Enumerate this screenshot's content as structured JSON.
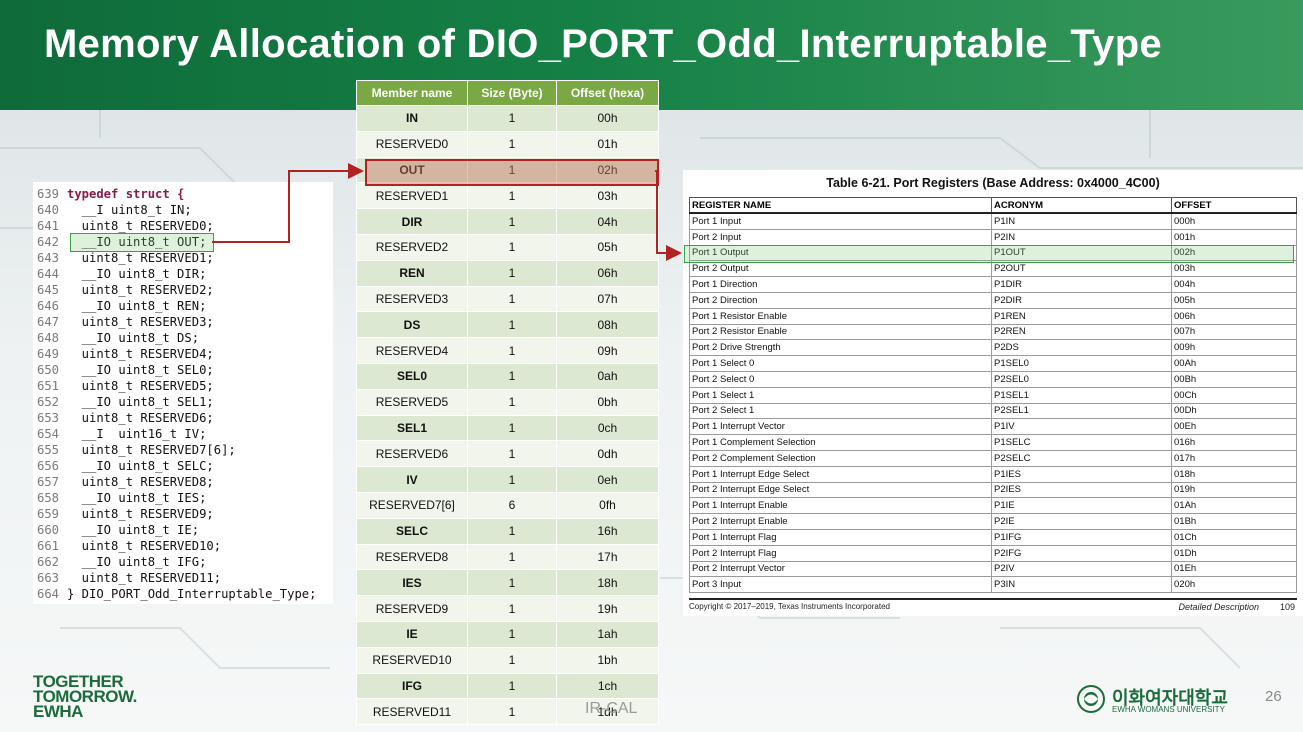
{
  "slide": {
    "title": "Memory Allocation of DIO_PORT_Odd_Interruptable_Type",
    "page_number": "26",
    "watermark": "IR-CAL",
    "logo_left": [
      "TOGETHER",
      "TOMORROW.",
      "EWHA"
    ],
    "logo_right_kr": "이화여자대학교",
    "logo_right_en": "EWHA WOMANS UNIVERSITY"
  },
  "code": [
    {
      "n": "639",
      "t": "typedef struct {"
    },
    {
      "n": "640",
      "t": "  __I uint8_t IN;"
    },
    {
      "n": "641",
      "t": "  uint8_t RESERVED0;"
    },
    {
      "n": "642",
      "t": "  __IO uint8_t OUT;"
    },
    {
      "n": "643",
      "t": "  uint8_t RESERVED1;"
    },
    {
      "n": "644",
      "t": "  __IO uint8_t DIR;"
    },
    {
      "n": "645",
      "t": "  uint8_t RESERVED2;"
    },
    {
      "n": "646",
      "t": "  __IO uint8_t REN;"
    },
    {
      "n": "647",
      "t": "  uint8_t RESERVED3;"
    },
    {
      "n": "648",
      "t": "  __IO uint8_t DS;"
    },
    {
      "n": "649",
      "t": "  uint8_t RESERVED4;"
    },
    {
      "n": "650",
      "t": "  __IO uint8_t SEL0;"
    },
    {
      "n": "651",
      "t": "  uint8_t RESERVED5;"
    },
    {
      "n": "652",
      "t": "  __IO uint8_t SEL1;"
    },
    {
      "n": "653",
      "t": "  uint8_t RESERVED6;"
    },
    {
      "n": "654",
      "t": "  __I  uint16_t IV;"
    },
    {
      "n": "655",
      "t": "  uint8_t RESERVED7[6];"
    },
    {
      "n": "656",
      "t": "  __IO uint8_t SELC;"
    },
    {
      "n": "657",
      "t": "  uint8_t RESERVED8;"
    },
    {
      "n": "658",
      "t": "  __IO uint8_t IES;"
    },
    {
      "n": "659",
      "t": "  uint8_t RESERVED9;"
    },
    {
      "n": "660",
      "t": "  __IO uint8_t IE;"
    },
    {
      "n": "661",
      "t": "  uint8_t RESERVED10;"
    },
    {
      "n": "662",
      "t": "  __IO uint8_t IFG;"
    },
    {
      "n": "663",
      "t": "  uint8_t RESERVED11;"
    },
    {
      "n": "664",
      "t": "} DIO_PORT_Odd_Interruptable_Type;"
    }
  ],
  "member_table": {
    "headers": [
      "Member name",
      "Size (Byte)",
      "Offset (hexa)"
    ],
    "rows": [
      [
        "IN",
        "1",
        "00h"
      ],
      [
        "RESERVED0",
        "1",
        "01h"
      ],
      [
        "OUT",
        "1",
        "02h"
      ],
      [
        "RESERVED1",
        "1",
        "03h"
      ],
      [
        "DIR",
        "1",
        "04h"
      ],
      [
        "RESERVED2",
        "1",
        "05h"
      ],
      [
        "REN",
        "1",
        "06h"
      ],
      [
        "RESERVED3",
        "1",
        "07h"
      ],
      [
        "DS",
        "1",
        "08h"
      ],
      [
        "RESERVED4",
        "1",
        "09h"
      ],
      [
        "SEL0",
        "1",
        "0ah"
      ],
      [
        "RESERVED5",
        "1",
        "0bh"
      ],
      [
        "SEL1",
        "1",
        "0ch"
      ],
      [
        "RESERVED6",
        "1",
        "0dh"
      ],
      [
        "IV",
        "1",
        "0eh"
      ],
      [
        "RESERVED7[6]",
        "6",
        "0fh"
      ],
      [
        "SELC",
        "1",
        "16h"
      ],
      [
        "RESERVED8",
        "1",
        "17h"
      ],
      [
        "IES",
        "1",
        "18h"
      ],
      [
        "RESERVED9",
        "1",
        "19h"
      ],
      [
        "IE",
        "1",
        "1ah"
      ],
      [
        "RESERVED10",
        "1",
        "1bh"
      ],
      [
        "IFG",
        "1",
        "1ch"
      ],
      [
        "RESERVED11",
        "1",
        "1dh"
      ]
    ]
  },
  "datasheet": {
    "title": "Table 6-21. Port Registers (Base Address: 0x4000_4C00)",
    "headers": [
      "REGISTER NAME",
      "ACRONYM",
      "OFFSET"
    ],
    "rows": [
      [
        "Port 1 Input",
        "P1IN",
        "000h"
      ],
      [
        "Port 2 Input",
        "P2IN",
        "001h"
      ],
      [
        "Port 1 Output",
        "P1OUT",
        "002h"
      ],
      [
        "Port 2 Output",
        "P2OUT",
        "003h"
      ],
      [
        "Port 1 Direction",
        "P1DIR",
        "004h"
      ],
      [
        "Port 2 Direction",
        "P2DIR",
        "005h"
      ],
      [
        "Port 1 Resistor Enable",
        "P1REN",
        "006h"
      ],
      [
        "Port 2 Resistor Enable",
        "P2REN",
        "007h"
      ],
      [
        "Port 2 Drive Strength",
        "P2DS",
        "009h"
      ],
      [
        "Port 1 Select 0",
        "P1SEL0",
        "00Ah"
      ],
      [
        "Port 2 Select 0",
        "P2SEL0",
        "00Bh"
      ],
      [
        "Port 1 Select 1",
        "P1SEL1",
        "00Ch"
      ],
      [
        "Port 2 Select 1",
        "P2SEL1",
        "00Dh"
      ],
      [
        "Port 1 Interrupt Vector",
        "P1IV",
        "00Eh"
      ],
      [
        "Port 1 Complement Selection",
        "P1SELC",
        "016h"
      ],
      [
        "Port 2 Complement Selection",
        "P2SELC",
        "017h"
      ],
      [
        "Port 1 Interrupt Edge Select",
        "P1IES",
        "018h"
      ],
      [
        "Port 2 Interrupt Edge Select",
        "P2IES",
        "019h"
      ],
      [
        "Port 1 Interrupt Enable",
        "P1IE",
        "01Ah"
      ],
      [
        "Port 2 Interrupt Enable",
        "P2IE",
        "01Bh"
      ],
      [
        "Port 1 Interrupt Flag",
        "P1IFG",
        "01Ch"
      ],
      [
        "Port 2 Interrupt Flag",
        "P2IFG",
        "01Dh"
      ],
      [
        "Port 2 Interrupt Vector",
        "P2IV",
        "01Eh"
      ],
      [
        "Port 3 Input",
        "P3IN",
        "020h"
      ]
    ],
    "copyright": "Copyright © 2017–2019, Texas Instruments Incorporated",
    "section": "Detailed Description",
    "page": "109"
  },
  "colors": {
    "header_green": "#158046",
    "table_header": "#7aa845",
    "highlight_red": "#b32222",
    "highlight_green": "#3aa04a"
  }
}
